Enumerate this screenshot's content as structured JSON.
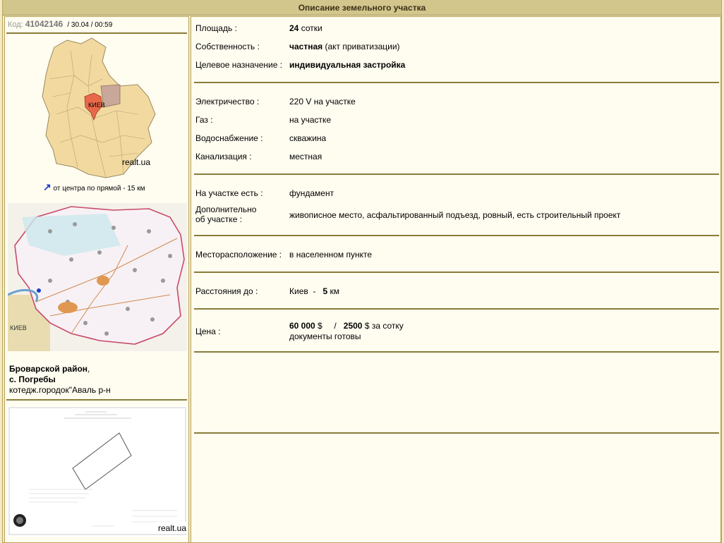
{
  "header": {
    "title": "Описание земельного участка"
  },
  "code": {
    "label": "Код:",
    "number": "41042146",
    "date": "/ 30.04 / 00:59"
  },
  "region_map": {
    "city_label": "КИЕВ",
    "watermark": "realt.ua"
  },
  "distance_note": "от центра по прямой - 15 км",
  "district_map": {
    "city_label": "КИЕВ"
  },
  "location": {
    "district": "Броварской район",
    "district_suffix": ",",
    "village": "с. Погребы",
    "detail": "котедж.городок\"Аваль р-н"
  },
  "plan": {
    "watermark": "realt.ua"
  },
  "details": {
    "area": {
      "label": "Площадь :",
      "value": "24",
      "unit": "сотки"
    },
    "ownership": {
      "label": "Собственность :",
      "value": "частная",
      "note": "(акт приватизации)"
    },
    "purpose": {
      "label": "Целевое назначение :",
      "value": "индивидуальная застройка"
    },
    "electricity": {
      "label": "Электричество :",
      "value": "220 V на участке"
    },
    "gas": {
      "label": "Газ :",
      "value": "на участке"
    },
    "water": {
      "label": "Водоснабжение :",
      "value": "скважина"
    },
    "sewer": {
      "label": "Канализация :",
      "value": "местная"
    },
    "onsite": {
      "label": "На участке есть :",
      "value": "фундамент"
    },
    "extra": {
      "label_line1": "Дополнительно",
      "label_line2": "об участке :",
      "value": "живописное место, асфальтированный подъезд, ровный, есть строительный проект"
    },
    "location": {
      "label": "Месторасположение :",
      "value": "в населенном пункте"
    },
    "distance": {
      "label": "Расстояния до :",
      "city": "Киев",
      "dash": "-",
      "km": "5",
      "unit": "км"
    },
    "price": {
      "label": "Цена :",
      "total": "60 000",
      "total_currency": "$",
      "slash": "/",
      "per_unit": "2500",
      "per_unit_suffix": "$ за сотку",
      "docs": "документы готовы"
    }
  },
  "colors": {
    "header_bg": "#d3c68c",
    "page_bg": "#f3ebc4",
    "panel_bg": "#fffcf0",
    "rule": "#8a7c3a",
    "map_city": "#e8694a"
  }
}
